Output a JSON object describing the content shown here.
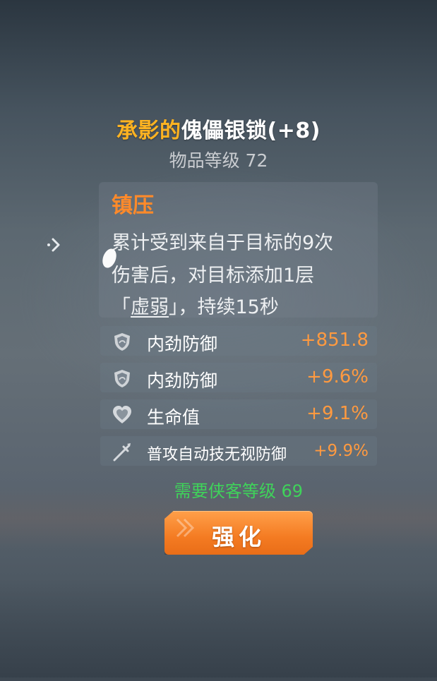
{
  "item": {
    "title_prefix": "承影的",
    "title_name": "傀儡银锁(+8)",
    "level_text": "物品等级 72"
  },
  "effect": {
    "name": "镇压",
    "line1": "累计受到来自于目标的9次",
    "line2": "伤害后，对目标添加1层",
    "line3_open": "「",
    "line3_keyword": "虚弱",
    "line3_rest": "」，持续15秒"
  },
  "stats": [
    {
      "name": "内劲防御",
      "value": "+851.8",
      "icon": "shield-icon"
    },
    {
      "name": "内劲防御",
      "value": "+9.6%",
      "icon": "shield-icon"
    },
    {
      "name": "生命值",
      "value": "+9.1%",
      "icon": "heart-icon"
    },
    {
      "name": "普攻自动技无视防御",
      "value": "+9.9%",
      "icon": "sword-icon"
    }
  ],
  "requirement": "需要侠客等级 69",
  "enhance_button": "强化",
  "colors": {
    "title_prefix": "#ffb321",
    "effect_name": "#ff8a2a",
    "stat_value": "#ff9a40",
    "requirement": "#3fd35a",
    "button": "#f47b22"
  }
}
